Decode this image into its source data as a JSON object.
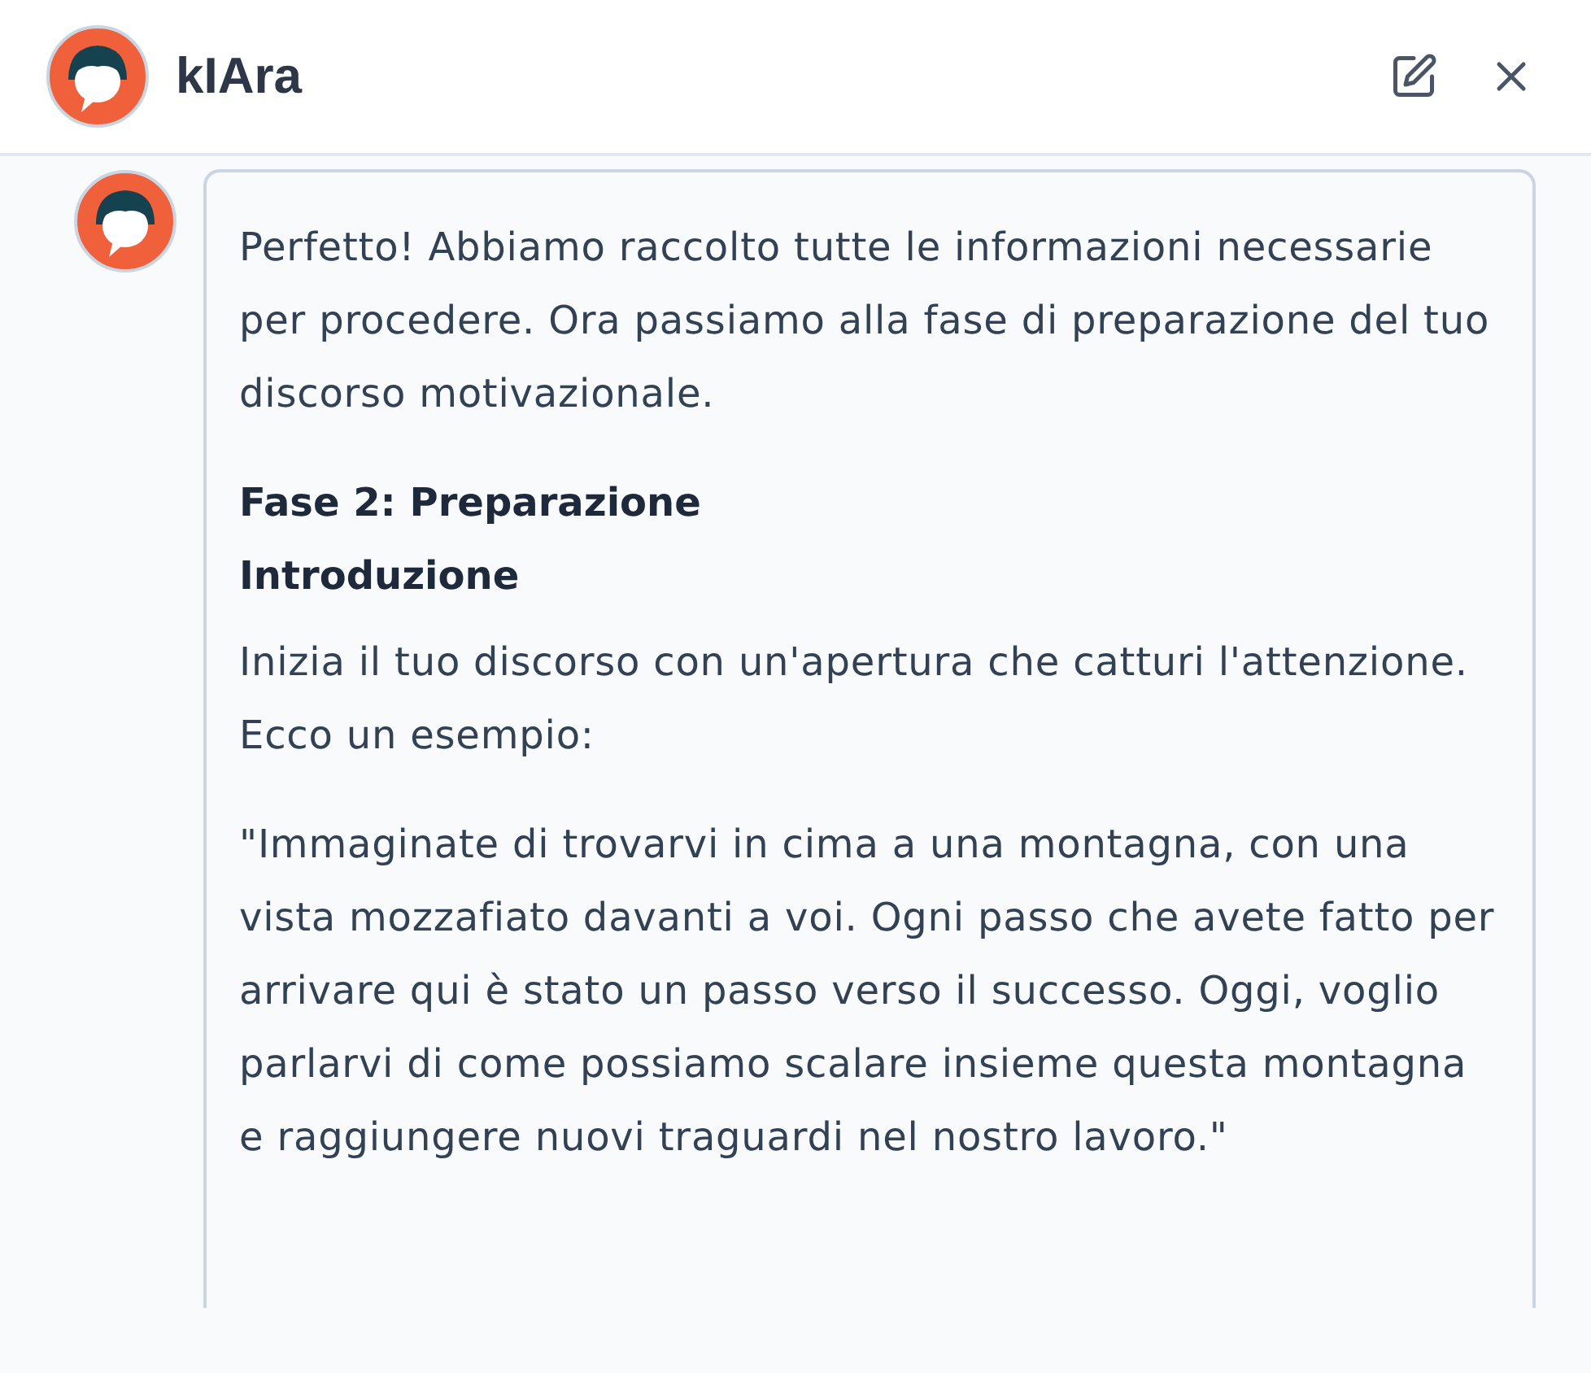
{
  "header": {
    "title": "kIAra",
    "actions": [
      {
        "kind": "edit"
      },
      {
        "kind": "close"
      }
    ]
  },
  "messages": [
    {
      "blocks": [
        {
          "kind": "paragraph",
          "text": "Perfetto! Abbiamo raccolto tutte le informazioni necessarie per procedere. Ora passiamo alla fase di preparazione del tuo discorso motivazionale."
        },
        {
          "kind": "heading",
          "text": "Fase 2: Preparazione"
        },
        {
          "kind": "subheading",
          "text": "Introduzione"
        },
        {
          "kind": "paragraph",
          "text": "Inizia il tuo discorso con un'apertura che catturi l'attenzione. Ecco un esempio:"
        },
        {
          "kind": "paragraph",
          "text": "\"Immaginate di trovarvi in cima a una montagna, con una vista mozzafiato davanti a voi. Ogni passo che avete fatto per arrivare qui è stato un passo verso il successo. Oggi, voglio parlarvi di come possiamo scalare insieme questa montagna e raggiungere nuovi traguardi nel nostro lavoro.\""
        }
      ]
    }
  ]
}
